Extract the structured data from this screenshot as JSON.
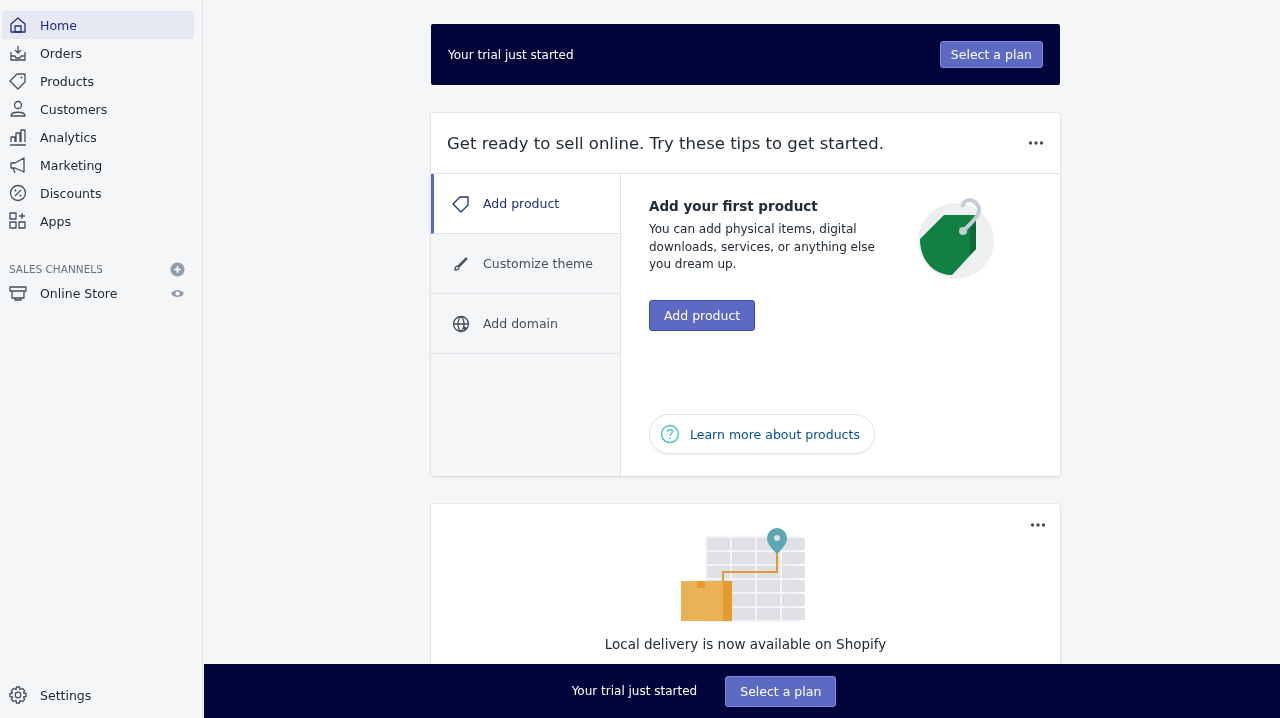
{
  "sidebar": {
    "items": [
      {
        "label": "Home",
        "selected": true
      },
      {
        "label": "Orders",
        "selected": false
      },
      {
        "label": "Products",
        "selected": false
      },
      {
        "label": "Customers",
        "selected": false
      },
      {
        "label": "Analytics",
        "selected": false
      },
      {
        "label": "Marketing",
        "selected": false
      },
      {
        "label": "Discounts",
        "selected": false
      },
      {
        "label": "Apps",
        "selected": false
      }
    ],
    "section_heading": "SALES CHANNELS",
    "channels": [
      {
        "label": "Online Store"
      }
    ],
    "settings": "Settings"
  },
  "trial_banner": {
    "text": "Your trial just started",
    "button": "Select a plan"
  },
  "setup_card": {
    "title": "Get ready to sell online. Try these tips to get started.",
    "tabs": [
      {
        "label": "Add product",
        "selected": true
      },
      {
        "label": "Customize theme",
        "selected": false
      },
      {
        "label": "Add domain",
        "selected": false
      }
    ],
    "panel": {
      "heading": "Add your first product",
      "body": "You can add physical items, digital downloads, services, or anything else you dream up.",
      "button": "Add product",
      "link": "Learn more about products"
    }
  },
  "delivery_card": {
    "heading": "Local delivery is now available on Shopify"
  },
  "bottom_bar": {
    "text": "Your trial just started",
    "button": "Select a plan"
  }
}
